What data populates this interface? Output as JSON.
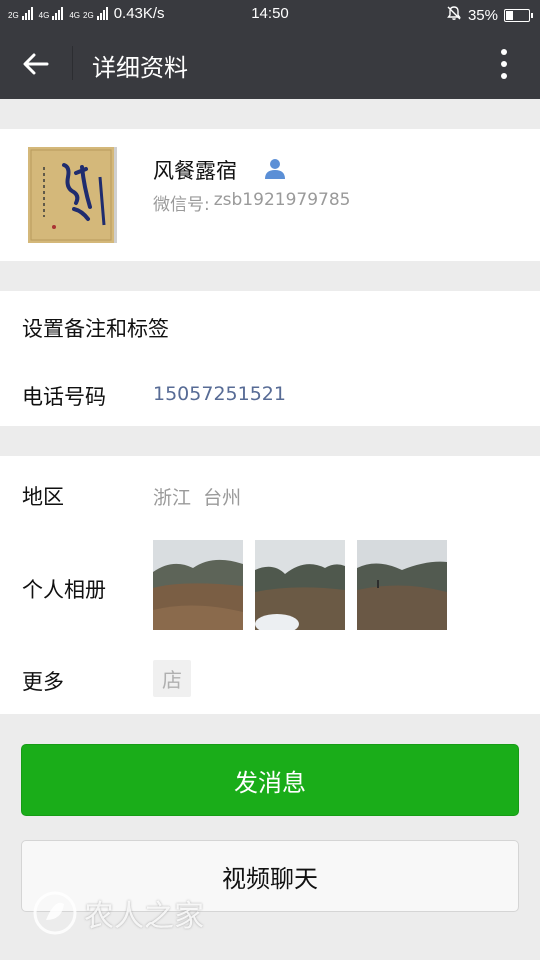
{
  "status_bar": {
    "sim1": "2G",
    "sim1_net": "4G",
    "sim2_net": "4G",
    "sim2": "2G",
    "speed": "0.43K/s",
    "time": "14:50",
    "battery": "35%",
    "battery_level": 0.35
  },
  "header": {
    "title": "详细资料",
    "back_icon": "arrow-left-icon",
    "more_icon": "more-vertical-icon"
  },
  "profile": {
    "nickname": "风餐露宿",
    "wechat_id_label": "微信号:",
    "wechat_id": "zsb1921979785",
    "avatar_text": "诚信",
    "user_icon": "user-icon"
  },
  "info": {
    "remark_label": "设置备注和标签",
    "phone_label": "电话号码",
    "phone_value": "15057251521"
  },
  "details": {
    "region_label": "地区",
    "region_value": "浙江  台州",
    "album_label": "个人相册",
    "more_label": "更多",
    "shop_icon_text": "店"
  },
  "actions": {
    "send_message": "发消息",
    "video_chat": "视频聊天"
  },
  "watermark": "农人之家",
  "colors": {
    "bar_bg": "#393a3f",
    "accent_green": "#1aad19",
    "link_blue": "#576b95"
  }
}
